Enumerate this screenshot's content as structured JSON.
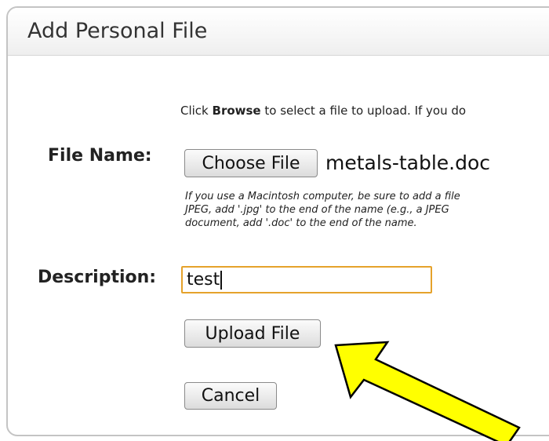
{
  "dialog": {
    "title": "Add Personal File",
    "instructions_pre": "Click ",
    "instructions_bold": "Browse",
    "instructions_post": " to select a file to upload. If you do"
  },
  "file_field": {
    "label": "File Name:",
    "choose_button": "Choose File",
    "selected_file": "metals-table.doc",
    "help_lines": [
      "If you use a Macintosh computer, be sure to add a file",
      "JPEG, add '.jpg' to the end of the name (e.g., a JPEG",
      "document, add '.doc' to the end of the name."
    ]
  },
  "description_field": {
    "label": "Description:",
    "value": "test"
  },
  "actions": {
    "upload_label": "Upload File",
    "cancel_label": "Cancel"
  },
  "annotation": {
    "arrow_color": "#ffff00",
    "arrow_outline": "#000000"
  },
  "colors": {
    "input_focus_border": "#e5a22b",
    "panel_border": "#c4c4c4"
  }
}
